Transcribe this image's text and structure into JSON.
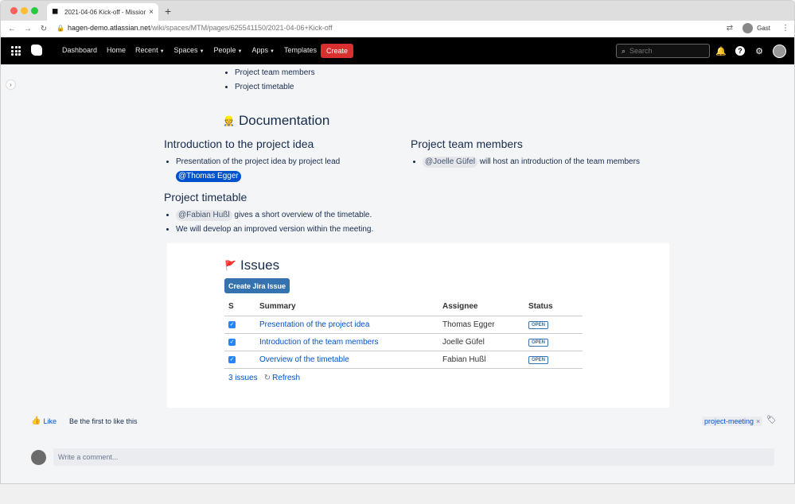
{
  "browser": {
    "tab_title": "2021-04-06 Kick-off - Mission",
    "tab_close": "×",
    "new_tab": "+",
    "url_host": "hagen-demo.atlassian.net",
    "url_path": "/wiki/spaces/MTM/pages/625541150/2021-04-06+Kick-off",
    "profile_label": "Gast",
    "back": "←",
    "forward": "→",
    "reload": "↻",
    "kebab": "⋮"
  },
  "topnav": {
    "items": [
      "Dashboard",
      "Home",
      "Recent",
      "Spaces",
      "People",
      "Apps",
      "Templates"
    ],
    "create_label": "Create",
    "search_placeholder": "Search"
  },
  "page": {
    "top_bullets": [
      "Project team members",
      "Project timetable"
    ],
    "documentation_heading": "Documentation",
    "intro": {
      "heading": "Introduction to the project idea",
      "bullet_text": "Presentation of the project idea by project lead",
      "mention": "@Thomas Egger"
    },
    "team": {
      "heading": "Project team members",
      "mention": "@Joelle Güfel",
      "bullet_text": " will host an introduction of the team members"
    },
    "timetable": {
      "heading": "Project timetable",
      "mention": "@Fabian Hußl",
      "bullet1_text": " gives a short overview of the timetable.",
      "bullet2_text": "We will develop an improved version within the meeting."
    }
  },
  "jira": {
    "heading": "Issues",
    "create_button": "Create Jira Issue",
    "columns": [
      "S",
      "Summary",
      "Assignee",
      "Status"
    ],
    "rows": [
      {
        "summary": "Presentation of the project idea",
        "assignee": "Thomas Egger",
        "status": "OPEN"
      },
      {
        "summary": "Introduction of the team members",
        "assignee": "Joelle Güfel",
        "status": "OPEN"
      },
      {
        "summary": "Overview of the timetable",
        "assignee": "Fabian Hußl",
        "status": "OPEN"
      }
    ],
    "count_label": "3 issues",
    "refresh_label": "Refresh"
  },
  "footer": {
    "like_label": "Like",
    "like_hint": "Be the first to like this",
    "label_tag": "project-meeting",
    "comment_placeholder": "Write a comment..."
  },
  "colors": {
    "topnav_bg": "#000000",
    "create_btn": "#d9302f",
    "link": "#0052cc",
    "jira_button": "#3572b0"
  }
}
